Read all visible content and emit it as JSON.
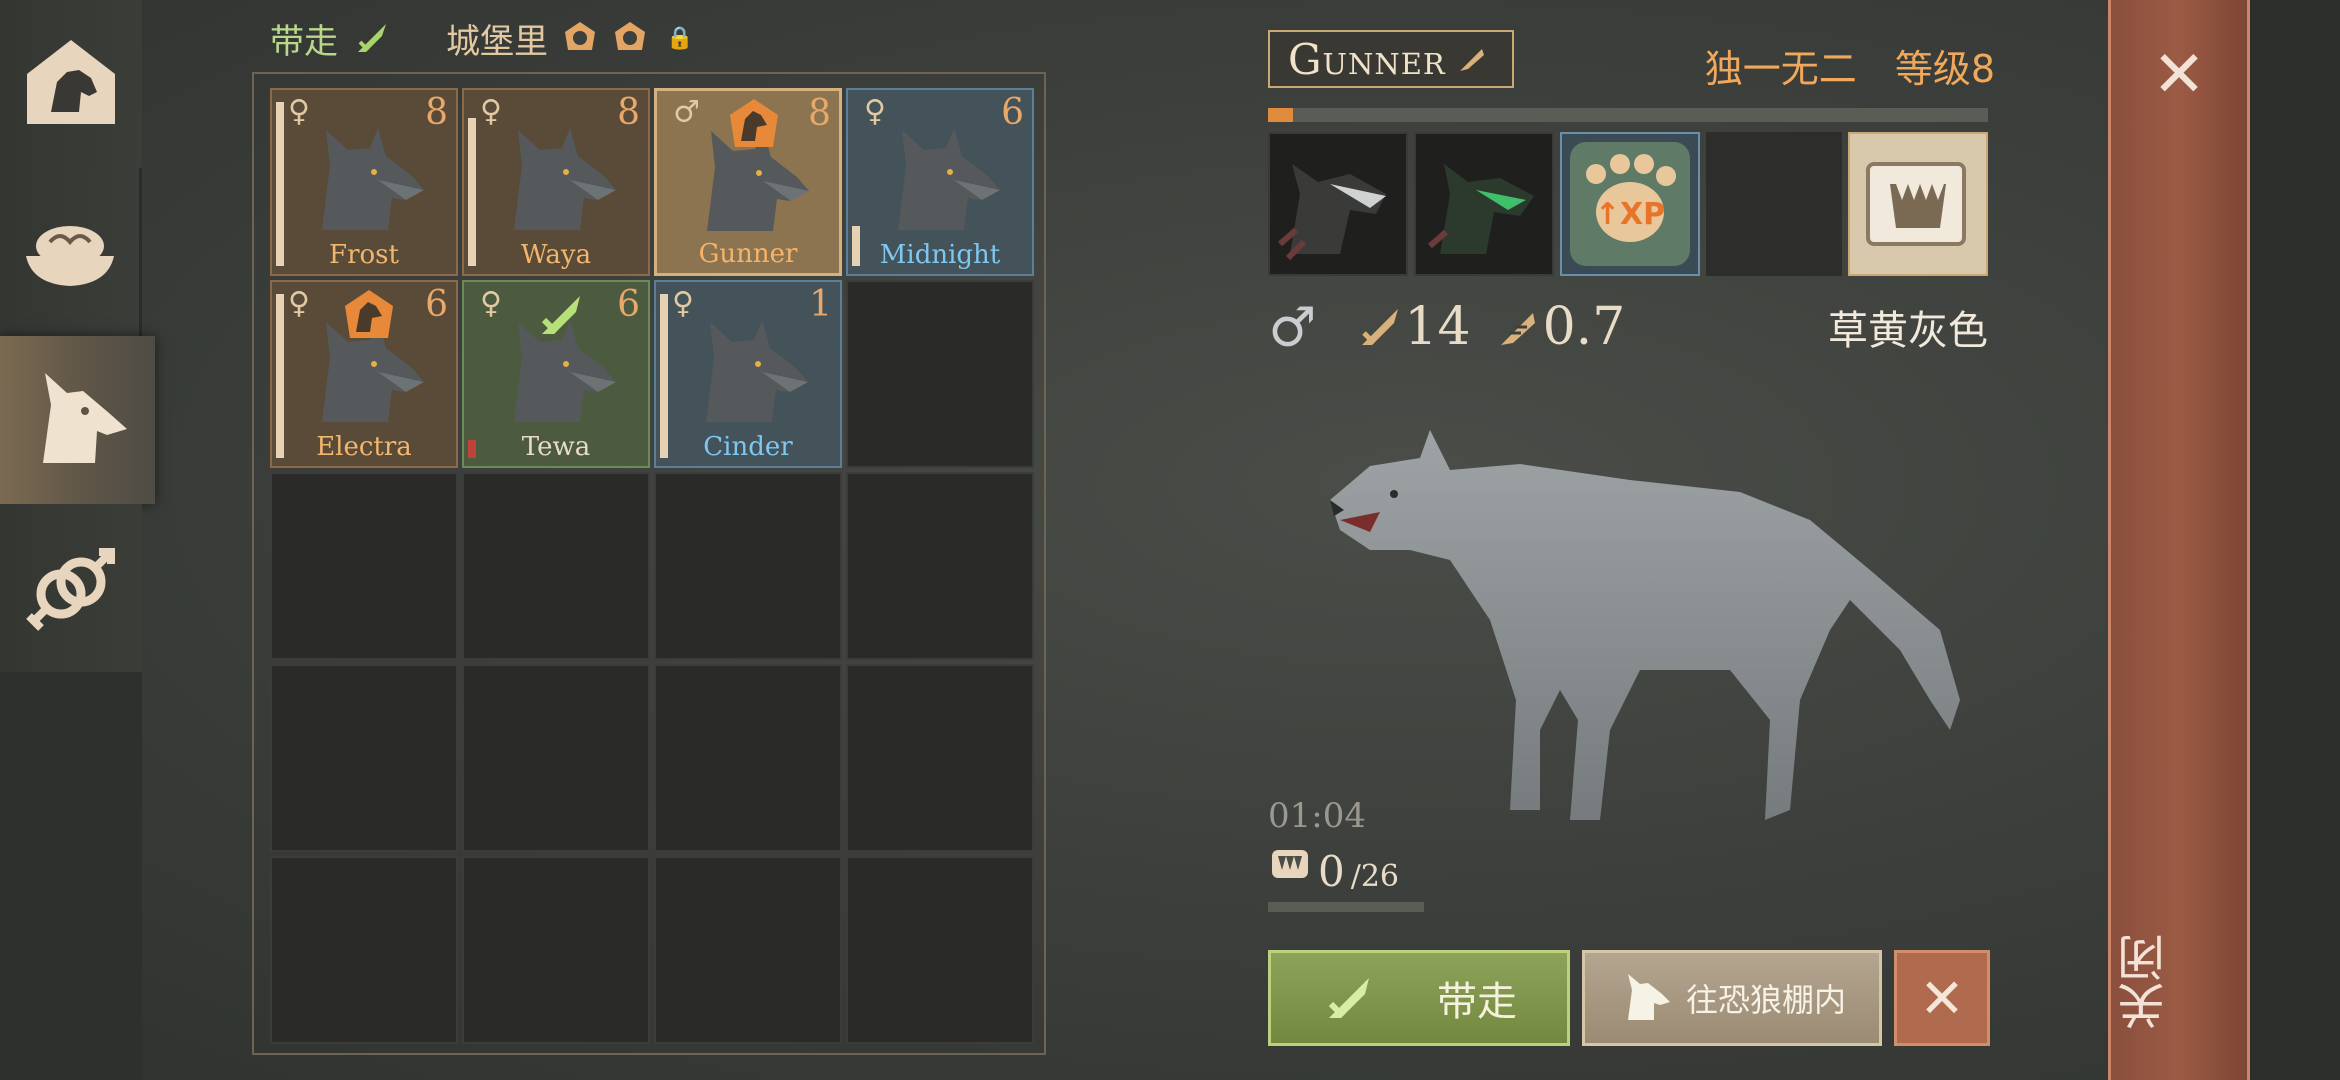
{
  "rail": {
    "tabs": [
      {
        "name": "pack-tab",
        "icon": "wolf-house-icon"
      },
      {
        "name": "food-tab",
        "icon": "meat-bowl-icon"
      },
      {
        "name": "wolves-tab",
        "icon": "wolf-head-icon",
        "active": true
      },
      {
        "name": "breeding-tab",
        "icon": "gender-link-icon"
      }
    ]
  },
  "filters": {
    "take": "带走",
    "castle": "城堡里"
  },
  "wolves": [
    {
      "name": "Frost",
      "level": "8",
      "sex": "♀",
      "style": "orange",
      "badge": ""
    },
    {
      "name": "Waya",
      "level": "8",
      "sex": "♀",
      "style": "orange",
      "badge": ""
    },
    {
      "name": "Gunner",
      "level": "8",
      "sex": "♂",
      "style": "selected",
      "badge": "alpha"
    },
    {
      "name": "Midnight",
      "level": "6",
      "sex": "♀",
      "style": "blue",
      "badge": ""
    },
    {
      "name": "Electra",
      "level": "6",
      "sex": "♀",
      "style": "orange",
      "badge": "alpha"
    },
    {
      "name": "Tewa",
      "level": "6",
      "sex": "♀",
      "style": "green",
      "badge": "take"
    },
    {
      "name": "Cinder",
      "level": "1",
      "sex": "♀",
      "style": "blue",
      "badge": ""
    }
  ],
  "detail": {
    "name": "Gunner",
    "rarity": "独一无二",
    "level_text": "等级8",
    "xp_fraction": 0.035,
    "sex": "♂",
    "attack": "14",
    "speed": "0.7",
    "coat_color": "草黄灰色",
    "timer": "01:04",
    "food_current": "0",
    "food_total": "/26"
  },
  "actions": {
    "take": "带走",
    "pen": "往恐狼棚内",
    "cancel": "✕"
  },
  "close": {
    "icon": "✕",
    "label": "关闭"
  },
  "colors": {
    "accent_orange": "#f0a85a",
    "take_green": "#8ea35a",
    "close_red": "#9b5b44"
  }
}
